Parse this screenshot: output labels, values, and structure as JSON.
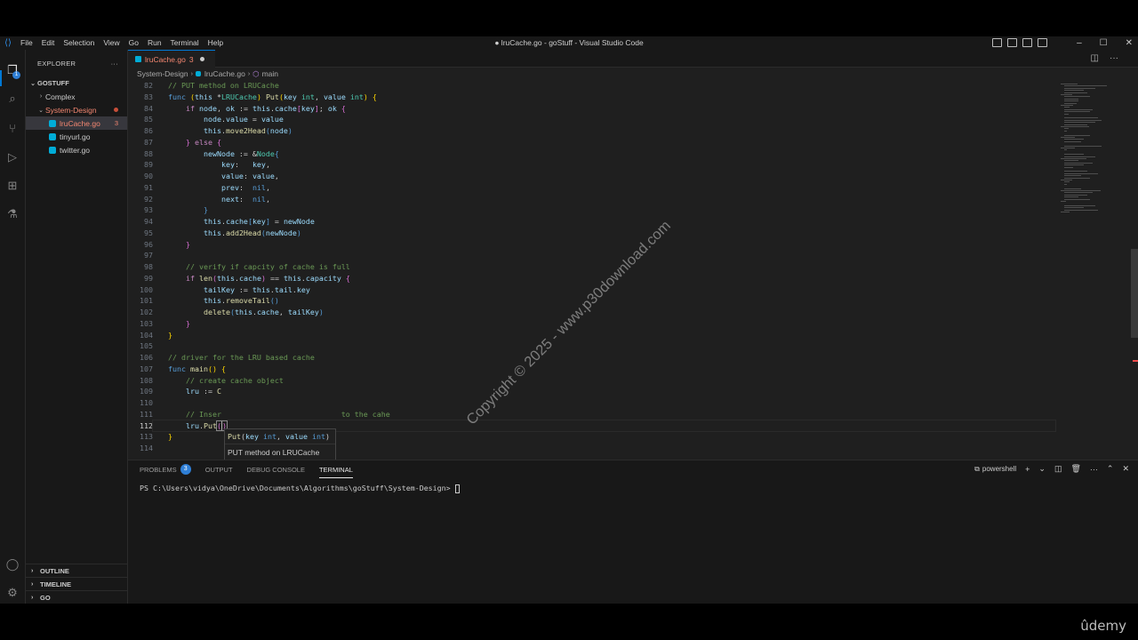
{
  "window_title": "● lruCache.go - goStuff - Visual Studio Code",
  "menu": [
    "File",
    "Edit",
    "Selection",
    "View",
    "Go",
    "Run",
    "Terminal",
    "Help"
  ],
  "activity": {
    "explorer_badge": "1"
  },
  "sidebar": {
    "title": "EXPLORER",
    "more": "···",
    "root": "GOSTUFF",
    "items": [
      {
        "label": "Complex",
        "kind": "folder",
        "expanded": false
      },
      {
        "label": "System-Design",
        "kind": "folder",
        "expanded": true
      },
      {
        "label": "lruCache.go",
        "kind": "file",
        "badge": "3",
        "selected": true
      },
      {
        "label": "tinyurl.go",
        "kind": "file"
      },
      {
        "label": "twitter.go",
        "kind": "file"
      }
    ],
    "sections": [
      "OUTLINE",
      "TIMELINE",
      "GO"
    ]
  },
  "tab": {
    "label": "lruCache.go",
    "count": "3"
  },
  "breadcrumb": {
    "folder": "System-Design",
    "file": "lruCache.go",
    "symbol": "main"
  },
  "code_lines": [
    {
      "n": "82",
      "html": "<span class='c'>// PUT method on LRUCache</span>"
    },
    {
      "n": "83",
      "html": "<span class='kb'>func</span> <span class='y'>(</span><span class='v'>this</span> *<span class='t'>LRUCache</span><span class='y'>)</span> <span class='f'>Put</span><span class='y'>(</span><span class='v'>key</span> <span class='t'>int</span>, <span class='v'>value</span> <span class='t'>int</span><span class='y'>)</span> <span class='y'>{</span>"
    },
    {
      "n": "84",
      "html": "    <span class='k'>if</span> <span class='v'>node</span>, <span class='v'>ok</span> := <span class='v'>this</span>.<span class='v'>cache</span><span class='p'>[</span><span class='v'>key</span><span class='p'>]</span>; <span class='v'>ok</span> <span class='p'>{</span>"
    },
    {
      "n": "85",
      "html": "        <span class='v'>node</span>.<span class='v'>value</span> = <span class='v'>value</span>"
    },
    {
      "n": "86",
      "html": "        <span class='v'>this</span>.<span class='f'>move2Head</span><span class='kb'>(</span><span class='v'>node</span><span class='kb'>)</span>"
    },
    {
      "n": "87",
      "html": "    <span class='p'>}</span> <span class='k'>else</span> <span class='p'>{</span>"
    },
    {
      "n": "88",
      "html": "        <span class='v'>newNode</span> := &amp;<span class='t'>Node</span><span class='kb'>{</span>"
    },
    {
      "n": "89",
      "html": "            <span class='v'>key</span>:   <span class='v'>key</span>,"
    },
    {
      "n": "90",
      "html": "            <span class='v'>value</span>: <span class='v'>value</span>,"
    },
    {
      "n": "91",
      "html": "            <span class='v'>prev</span>:  <span class='n'>nil</span>,"
    },
    {
      "n": "92",
      "html": "            <span class='v'>next</span>:  <span class='n'>nil</span>,"
    },
    {
      "n": "93",
      "html": "        <span class='kb'>}</span>"
    },
    {
      "n": "94",
      "html": "        <span class='v'>this</span>.<span class='v'>cache</span><span class='kb'>[</span><span class='v'>key</span><span class='kb'>]</span> = <span class='v'>newNode</span>"
    },
    {
      "n": "95",
      "html": "        <span class='v'>this</span>.<span class='f'>add2Head</span><span class='kb'>(</span><span class='v'>newNode</span><span class='kb'>)</span>"
    },
    {
      "n": "96",
      "html": "    <span class='p'>}</span>"
    },
    {
      "n": "97",
      "html": ""
    },
    {
      "n": "98",
      "html": "    <span class='c'>// verify if capcity of cache is full</span>"
    },
    {
      "n": "99",
      "html": "    <span class='k'>if</span> <span class='f'>len</span><span class='p'>(</span><span class='v'>this</span>.<span class='v'>cache</span><span class='p'>)</span> == <span class='v'>this</span>.<span class='v'>capacity</span> <span class='p'>{</span>"
    },
    {
      "n": "100",
      "html": "        <span class='v'>tailKey</span> := <span class='v'>this</span>.<span class='v'>tail</span>.<span class='v'>key</span>"
    },
    {
      "n": "101",
      "html": "        <span class='v'>this</span>.<span class='f'>removeTail</span><span class='kb'>()</span>"
    },
    {
      "n": "102",
      "html": "        <span class='f'>delete</span><span class='kb'>(</span><span class='v'>this</span>.<span class='v'>cache</span>, <span class='v'>tailKey</span><span class='kb'>)</span>"
    },
    {
      "n": "103",
      "html": "    <span class='p'>}</span>"
    },
    {
      "n": "104",
      "html": "<span class='y'>}</span>"
    },
    {
      "n": "105",
      "html": ""
    },
    {
      "n": "106",
      "html": "<span class='c'>// driver for the LRU based cache</span>"
    },
    {
      "n": "107",
      "html": "<span class='kb'>func</span> <span class='f'>main</span><span class='y'>()</span> <span class='y'>{</span>"
    },
    {
      "n": "108",
      "html": "    <span class='c'>// create cache object</span>"
    },
    {
      "n": "109",
      "html": "    <span class='v'>lru</span> := <span class='f'>C</span>"
    },
    {
      "n": "110",
      "html": ""
    },
    {
      "n": "111",
      "html": "    <span class='c'>// Inser                           to the cahe</span>"
    },
    {
      "n": "112",
      "html": "    <span class='v'>lru</span>.<span class='f'>Put</span><span class='bracket-box'><span class='p'>(</span><span class='cursor'></span><span class='p'>)</span></span>",
      "current": true
    },
    {
      "n": "113",
      "html": "<span class='y'>}</span>"
    },
    {
      "n": "114",
      "html": ""
    }
  ],
  "hover": {
    "signature_html": "<span class='f'>Put</span>(<span class='v'>key</span> <span class='kb'>int</span>, <span class='v'>value</span> <span class='kb'>int</span>)",
    "doc": "PUT method on LRUCache"
  },
  "panel": {
    "tabs": [
      {
        "label": "PROBLEMS",
        "count": "3"
      },
      {
        "label": "OUTPUT"
      },
      {
        "label": "DEBUG CONSOLE"
      },
      {
        "label": "TERMINAL",
        "active": true
      }
    ],
    "shell": "powershell",
    "prompt": "PS C:\\Users\\vidya\\OneDrive\\Documents\\Algorithms\\goStuff\\System-Design> "
  },
  "watermark": "Copyright © 2025 - www.p30download.com",
  "brand": "ûdemy",
  "colors": {
    "accent": "#0078d4",
    "error": "#f48771",
    "badge": "#2f7fd6"
  }
}
